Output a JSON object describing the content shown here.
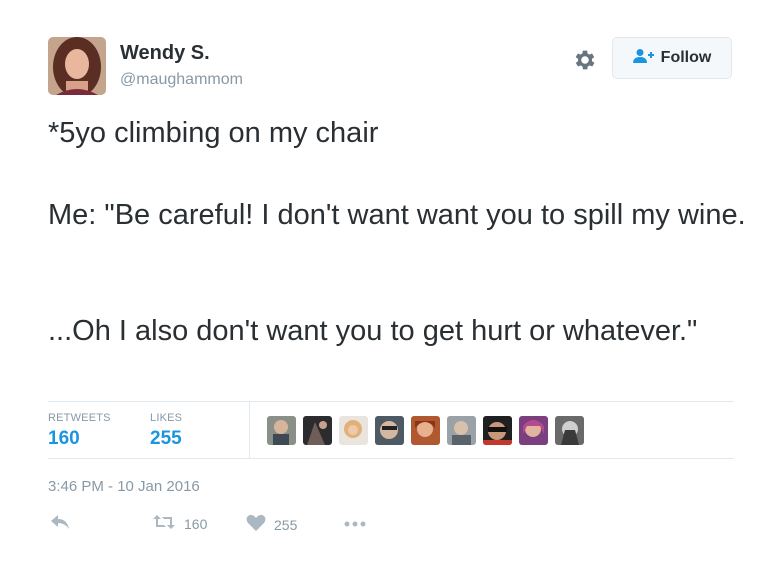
{
  "author": {
    "name": "Wendy S.",
    "handle": "@maughammom"
  },
  "header": {
    "follow_label": "Follow"
  },
  "tweet": {
    "line1": "*5yo climbing on my chair",
    "line2": "Me: \"Be careful! I don't want want you to spill my wine.",
    "line3": "...Oh I also don't want you to get hurt or whatever.\""
  },
  "stats": {
    "retweets_label": "RETWEETS",
    "retweets_value": "160",
    "likes_label": "LIKES",
    "likes_value": "255"
  },
  "likers_count": 9,
  "timestamp": "3:46 PM - 10 Jan 2016",
  "actions": {
    "retweet_count": "160",
    "like_count": "255"
  },
  "colors": {
    "link": "#1b95e0",
    "muted": "#8899a6",
    "text": "#292f33"
  },
  "icons": [
    "gear-icon",
    "follow-person-icon",
    "reply-icon",
    "retweet-icon",
    "heart-icon",
    "more-icon"
  ]
}
